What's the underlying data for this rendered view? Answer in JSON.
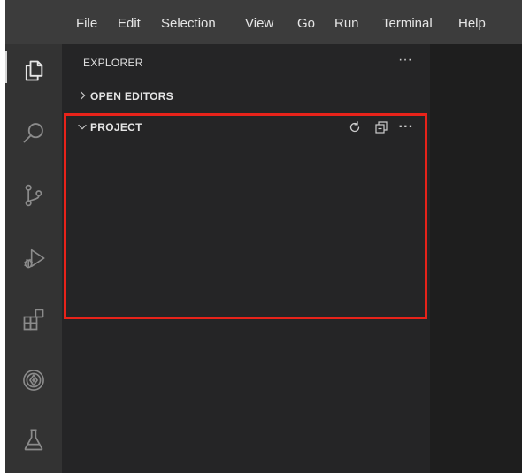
{
  "menubar": {
    "items": [
      "File",
      "Edit",
      "Selection",
      "View",
      "Go",
      "Run",
      "Terminal",
      "Help"
    ]
  },
  "activitybar": {
    "icons": [
      "explorer-icon",
      "search-icon",
      "source-control-icon",
      "run-debug-icon",
      "extensions-icon",
      "remote-explorer-icon",
      "testing-icon"
    ],
    "active": "explorer-icon"
  },
  "sidebar": {
    "title": "EXPLORER",
    "more_label": "···",
    "open_editors": {
      "label": "OPEN EDITORS",
      "expanded": false
    },
    "project": {
      "label": "PROJECT",
      "expanded": true,
      "actions": [
        "refresh-icon",
        "collapse-all-icon",
        "more-actions-icon"
      ],
      "more_label": "···"
    }
  },
  "highlight": {
    "color": "#e8231a"
  },
  "colors": {
    "menubar": "#3c3c3c",
    "activitybar": "#333333",
    "sidebar": "#252526",
    "editor": "#1e1e1e"
  }
}
